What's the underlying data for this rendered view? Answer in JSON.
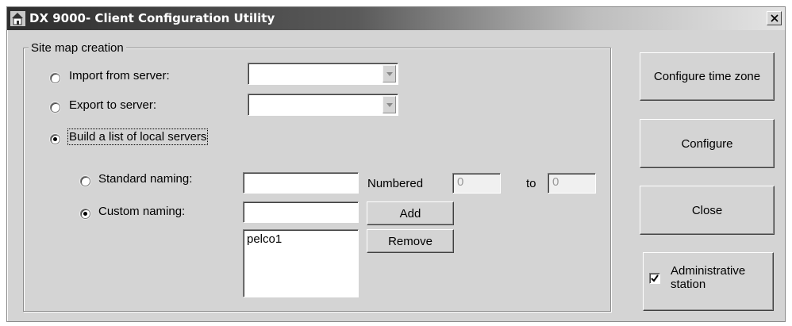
{
  "window": {
    "title": "DX 9000- Client Configuration Utility",
    "icon": "house-network-icon",
    "close_icon": "close-x-icon"
  },
  "site_map": {
    "group_label": "Site map creation",
    "import_label": "Import from server:",
    "import_selected": false,
    "export_label": "Export to server:",
    "export_selected": false,
    "build_label": "Build a list of local servers",
    "build_selected": true,
    "standard_label": "Standard naming:",
    "standard_selected": false,
    "standard_value": "",
    "numbered_label": "Numbered",
    "number_from": "0",
    "to_label": "to",
    "number_to": "0",
    "custom_label": "Custom naming:",
    "custom_selected": true,
    "custom_value": "",
    "add_label": "Add",
    "remove_label": "Remove",
    "server_list": [
      "pelco1"
    ]
  },
  "side_buttons": {
    "time_zone_label": "Configure time zone",
    "configure_label": "Configure",
    "close_label": "Close"
  },
  "admin_station": {
    "label": "Administrative station",
    "checked": true
  }
}
